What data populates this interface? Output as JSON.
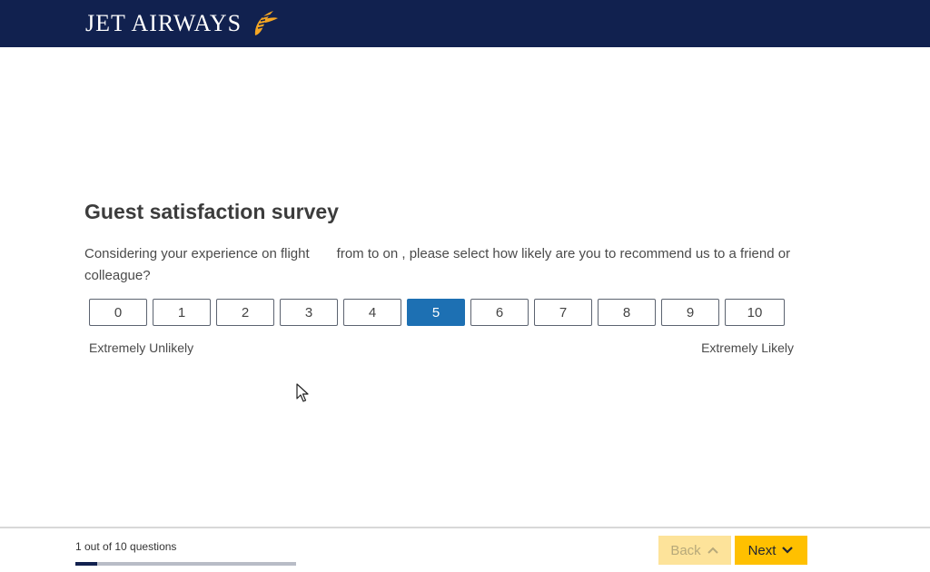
{
  "header": {
    "brand": "JET AIRWAYS",
    "logo_icon": "sun-swirl-icon",
    "background_color": "#11214f",
    "logo_color": "#f5a623"
  },
  "survey": {
    "title": "Guest satisfaction survey",
    "question_part1": "Considering your experience on flight",
    "question_part2": "from to on , please select how likely are you to recommend us to a friend or colleague?",
    "scale": [
      "0",
      "1",
      "2",
      "3",
      "4",
      "5",
      "6",
      "7",
      "8",
      "9",
      "10"
    ],
    "selected_value": "5",
    "selected_color": "#1d70b3",
    "label_low": "Extremely Unlikely",
    "label_high": "Extremely Likely"
  },
  "footer": {
    "progress_text": "1 out of 10 questions",
    "progress_fraction": 0.1,
    "back_label": "Back",
    "back_icon": "chevron-up-icon",
    "next_label": "Next",
    "next_icon": "chevron-down-icon",
    "accent_color": "#ffc000"
  }
}
